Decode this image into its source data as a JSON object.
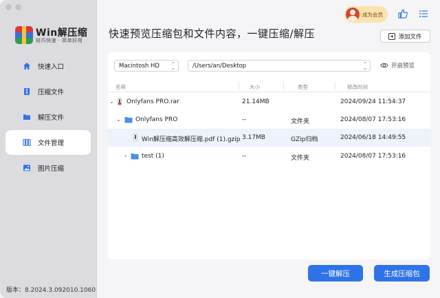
{
  "app": {
    "name": "Win解压缩",
    "tagline": "轻巧快速 · 简单好用",
    "version_label": "版本：8.2024.3.092010.1060"
  },
  "sidebar": {
    "items": [
      {
        "label": "快速入口",
        "icon": "home-icon",
        "active": false
      },
      {
        "label": "压缩文件",
        "icon": "archive-icon",
        "active": false
      },
      {
        "label": "解压文件",
        "icon": "folder-icon",
        "active": false
      },
      {
        "label": "文件管理",
        "icon": "files-icon",
        "active": true
      },
      {
        "label": "图片压缩",
        "icon": "image-icon",
        "active": false
      }
    ]
  },
  "header": {
    "member_label": "成为会员",
    "headline": "快速预览压缩包和文件内容，一键压缩/解压",
    "add_file_label": "添加文件"
  },
  "browser": {
    "volume": "Macintosh HD",
    "path": "/Users/an/Desktop",
    "preview_label": "开启预览",
    "columns": {
      "name": "名称",
      "size": "大小",
      "type": "类型",
      "modified": "修改时间"
    },
    "rows": [
      {
        "name": "Onlyfans PRO.rar",
        "size": "21.14MB",
        "type": "",
        "modified": "2024/09/24 11:54:37"
      },
      {
        "name": "Onlyfans PRO",
        "size": "--",
        "type": "文件夹",
        "modified": "2024/08/07 17:53:16"
      },
      {
        "name": "Win解压缩高效解压缩.pdf (1).gzip",
        "size": "3.17MB",
        "type": "GZip归档",
        "modified": "2024/06/18 14:49:55"
      },
      {
        "name": "test (1)",
        "size": "--",
        "type": "文件夹",
        "modified": "2024/08/07 17:53:16"
      }
    ]
  },
  "actions": {
    "extract_label": "一键解压",
    "compress_label": "生成压缩包"
  },
  "colors": {
    "accent": "#2e73e8",
    "member_bg": "#fbe3b1"
  }
}
